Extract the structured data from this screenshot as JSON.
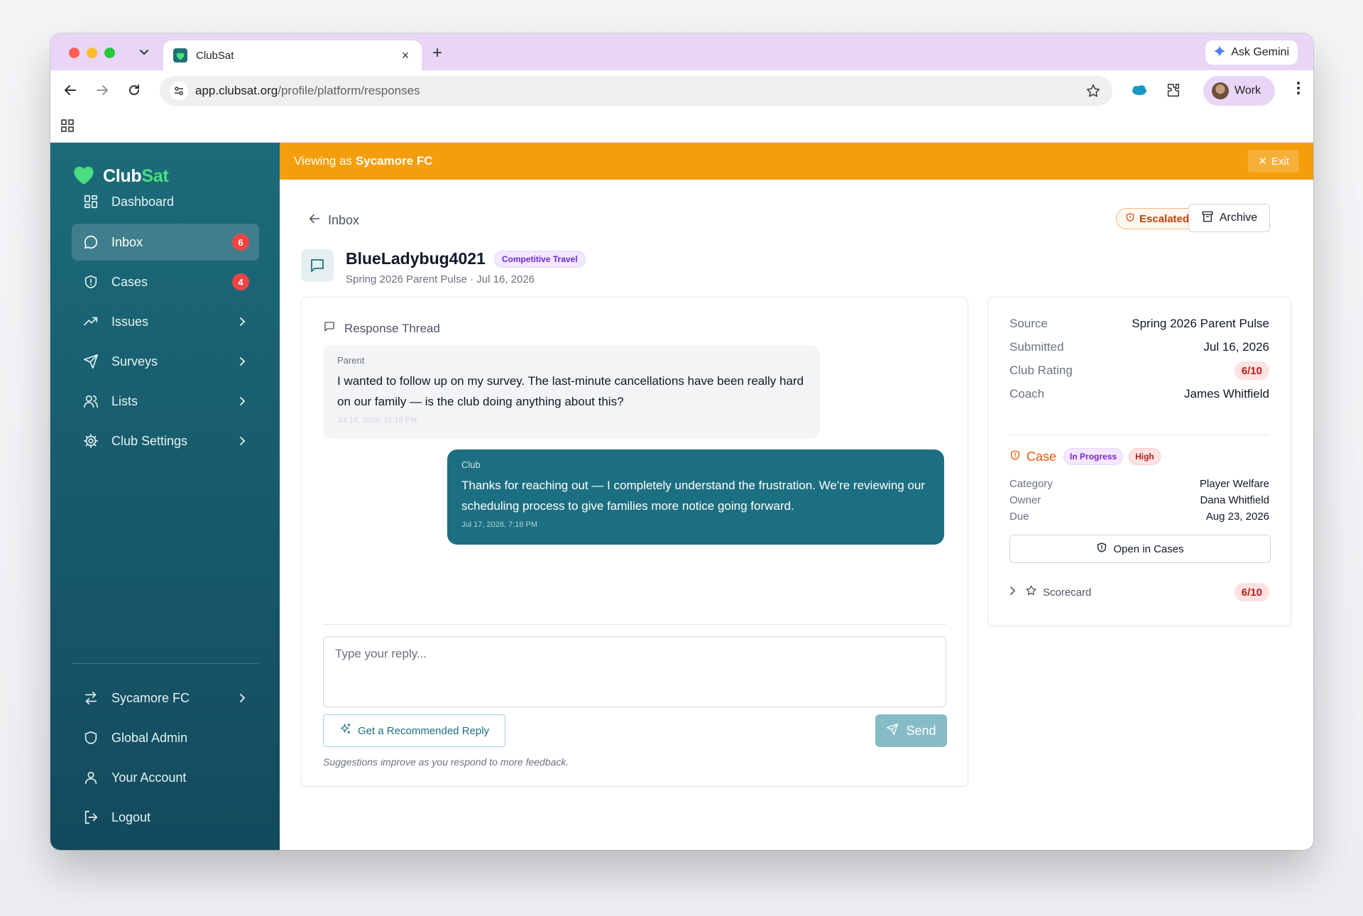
{
  "browser": {
    "tab_title": "ClubSat",
    "new_tab_symbol": "+",
    "ask_gemini_label": "Ask Gemini",
    "url_host": "app.clubsat.org",
    "url_path": "/profile/platform/responses",
    "profile_label": "Work"
  },
  "colors": {
    "sidebar": "#1c6b7a",
    "banner": "#f59e0b",
    "brand_accent": "#4ade80",
    "club_bubble": "#1c6f80",
    "badge_red": "#ef4444"
  },
  "brand": {
    "name_main": "Club",
    "name_accent": "Sat"
  },
  "sidebar": {
    "items": [
      {
        "label": "Dashboard",
        "icon": "grid-icon"
      },
      {
        "label": "Inbox",
        "icon": "message-icon",
        "badge": "6"
      },
      {
        "label": "Cases",
        "icon": "shield-icon",
        "badge": "4"
      },
      {
        "label": "Issues",
        "icon": "trending-icon"
      },
      {
        "label": "Surveys",
        "icon": "send-icon"
      },
      {
        "label": "Lists",
        "icon": "users-icon"
      },
      {
        "label": "Club Settings",
        "icon": "gear-icon"
      }
    ],
    "footer": [
      {
        "label": "Sycamore FC",
        "icon": "switch-icon"
      },
      {
        "label": "Global Admin",
        "icon": "shield-icon"
      },
      {
        "label": "Your Account",
        "icon": "user-icon"
      },
      {
        "label": "Logout",
        "icon": "logout-icon"
      }
    ]
  },
  "banner": {
    "prefix": "Viewing as",
    "club": "Sycamore FC",
    "exit_label": "Exit"
  },
  "header": {
    "back_label": "Inbox",
    "escalated_label": "Escalated",
    "archive_label": "Archive"
  },
  "conversation": {
    "name": "BlueLadybug4021",
    "tag": "Competitive Travel",
    "subtitle": "Spring 2026 Parent Pulse · Jul 16, 2026"
  },
  "thread": {
    "title": "Response Thread",
    "messages": [
      {
        "role": "Parent",
        "text": "I wanted to follow up on my survey. The last-minute cancellations have been really hard on our family — is the club doing anything about this?",
        "time": "Jul 16, 2026, 11:18 PM"
      },
      {
        "role": "Club",
        "text": "Thanks for reaching out — I completely understand the frustration. We're reviewing our scheduling process to give families more notice going forward.",
        "time": "Jul 17, 2026, 7:18 PM"
      }
    ],
    "reply_placeholder": "Type your reply...",
    "reply_value": "",
    "recommend_label": "Get a Recommended Reply",
    "send_label": "Send",
    "hint": "Suggestions improve as you respond to more feedback."
  },
  "details": {
    "source_label": "Source",
    "source_value": "Spring 2026 Parent Pulse",
    "submitted_label": "Submitted",
    "submitted_value": "Jul 16, 2026",
    "rating_label": "Club Rating",
    "rating_value": "6/10",
    "coach_label": "Coach",
    "coach_value": "James Whitfield",
    "case_label": "Case",
    "case_status": "In Progress",
    "case_priority": "High",
    "category_label": "Category",
    "category_value": "Player Welfare",
    "owner_label": "Owner",
    "owner_value": "Dana Whitfield",
    "due_label": "Due",
    "due_value": "Aug 23, 2026",
    "open_cases_label": "Open in Cases",
    "scorecard_label": "Scorecard",
    "scorecard_value": "6/10"
  }
}
